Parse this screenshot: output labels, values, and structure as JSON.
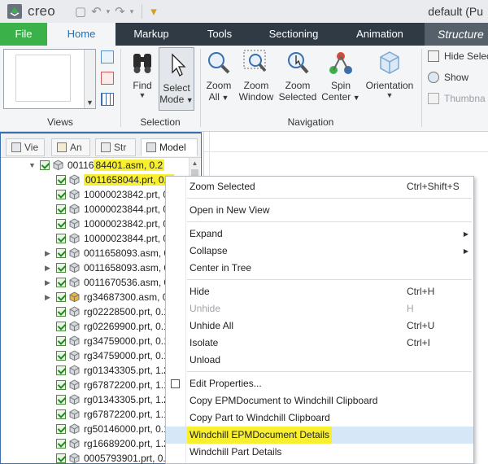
{
  "app": {
    "logo_text": "creo",
    "title": "default (Pu"
  },
  "tabs": [
    {
      "label": "File"
    },
    {
      "label": "Home"
    },
    {
      "label": "Markup"
    },
    {
      "label": "Tools"
    },
    {
      "label": "Sectioning"
    },
    {
      "label": "Animation"
    },
    {
      "label": "Structure"
    }
  ],
  "ribbon": {
    "views_label": "Views",
    "selection_label": "Selection",
    "navigation_label": "Navigation",
    "find_label": "Find",
    "select_mode_l1": "Select",
    "select_mode_l2": "Mode",
    "zoom_all_l1": "Zoom",
    "zoom_all_l2": "All",
    "zoom_window_l1": "Zoom",
    "zoom_window_l2": "Window",
    "zoom_selected_l1": "Zoom",
    "zoom_selected_l2": "Selected",
    "spin_center_l1": "Spin",
    "spin_center_l2": "Center",
    "orientation_label": "Orientation",
    "hide_selected": "Hide Selec",
    "show": "Show",
    "thumbnail": "Thumbna"
  },
  "panel_tabs": [
    {
      "label": "Vie"
    },
    {
      "label": "An"
    },
    {
      "label": "Str"
    },
    {
      "label": "Model"
    }
  ],
  "tree": [
    {
      "pre": "00116",
      "hl": "",
      "label": "84401.asm, 0.2",
      "type": "asm",
      "twisty": "open",
      "indent": 0
    },
    {
      "pre": "",
      "hl": "0011658044.prt, 0.2",
      "label": "",
      "type": "prt",
      "twisty": "",
      "indent": 1
    },
    {
      "pre": "",
      "hl": "",
      "label": "10000023842.prt, 0.",
      "type": "prt",
      "twisty": "",
      "indent": 1
    },
    {
      "pre": "",
      "hl": "",
      "label": "10000023844.prt, 0.",
      "type": "prt",
      "twisty": "",
      "indent": 1
    },
    {
      "pre": "",
      "hl": "",
      "label": "10000023842.prt, 0.",
      "type": "prt",
      "twisty": "",
      "indent": 1
    },
    {
      "pre": "",
      "hl": "",
      "label": "10000023844.prt, 0.",
      "type": "prt",
      "twisty": "",
      "indent": 1
    },
    {
      "pre": "",
      "hl": "",
      "label": "0011658093.asm, 0.",
      "type": "asm",
      "twisty": "closed",
      "indent": 1
    },
    {
      "pre": "",
      "hl": "",
      "label": "0011658093.asm, 0.",
      "type": "asm",
      "twisty": "closed",
      "indent": 1
    },
    {
      "pre": "",
      "hl": "",
      "label": "0011670536.asm, 0.",
      "type": "asm",
      "twisty": "closed",
      "indent": 1
    },
    {
      "pre": "",
      "hl": "",
      "label": "rg34687300.asm, 0.",
      "type": "asm-y",
      "twisty": "closed",
      "indent": 1
    },
    {
      "pre": "",
      "hl": "",
      "label": "rg02228500.prt, 0.1",
      "type": "prt",
      "twisty": "",
      "indent": 1
    },
    {
      "pre": "",
      "hl": "",
      "label": "rg02269900.prt, 0.1",
      "type": "prt",
      "twisty": "",
      "indent": 1
    },
    {
      "pre": "",
      "hl": "",
      "label": "rg34759000.prt, 0.1",
      "type": "prt",
      "twisty": "",
      "indent": 1
    },
    {
      "pre": "",
      "hl": "",
      "label": "rg34759000.prt, 0.1",
      "type": "prt",
      "twisty": "",
      "indent": 1
    },
    {
      "pre": "",
      "hl": "",
      "label": "rg01343305.prt, 1.2",
      "type": "prt",
      "twisty": "",
      "indent": 1
    },
    {
      "pre": "",
      "hl": "",
      "label": "rg67872200.prt, 1.1",
      "type": "prt",
      "twisty": "",
      "indent": 1
    },
    {
      "pre": "",
      "hl": "",
      "label": "rg01343305.prt, 1.2",
      "type": "prt",
      "twisty": "",
      "indent": 1
    },
    {
      "pre": "",
      "hl": "",
      "label": "rg67872200.prt, 1.1",
      "type": "prt",
      "twisty": "",
      "indent": 1
    },
    {
      "pre": "",
      "hl": "",
      "label": "rg50146000.prt, 0.1",
      "type": "prt",
      "twisty": "",
      "indent": 1
    },
    {
      "pre": "",
      "hl": "",
      "label": "rg16689200.prt, 1.2",
      "type": "prt",
      "twisty": "",
      "indent": 1
    },
    {
      "pre": "",
      "hl": "",
      "label": "0005793901.prt, 0.9",
      "type": "prt",
      "twisty": "",
      "indent": 1
    }
  ],
  "context_menu": [
    {
      "label": "Zoom Selected",
      "shortcut": "Ctrl+Shift+S",
      "kind": "item"
    },
    {
      "kind": "sep"
    },
    {
      "label": "Open in New View",
      "shortcut": "",
      "kind": "item"
    },
    {
      "kind": "sep"
    },
    {
      "label": "Expand",
      "shortcut": "",
      "kind": "submenu"
    },
    {
      "label": "Collapse",
      "shortcut": "",
      "kind": "submenu"
    },
    {
      "label": "Center in Tree",
      "shortcut": "",
      "kind": "item"
    },
    {
      "kind": "sep"
    },
    {
      "label": "Hide",
      "shortcut": "Ctrl+H",
      "kind": "item"
    },
    {
      "label": "Unhide",
      "shortcut": "H",
      "kind": "disabled"
    },
    {
      "label": "Unhide All",
      "shortcut": "Ctrl+U",
      "kind": "item"
    },
    {
      "label": "Isolate",
      "shortcut": "Ctrl+I",
      "kind": "item"
    },
    {
      "label": "Unload",
      "shortcut": "",
      "kind": "item"
    },
    {
      "kind": "sep"
    },
    {
      "label": "Edit Properties...",
      "shortcut": "",
      "kind": "checkbox"
    },
    {
      "label": "Copy EPMDocument to Windchill Clipboard",
      "shortcut": "",
      "kind": "item"
    },
    {
      "label": "Copy Part to Windchill Clipboard",
      "shortcut": "",
      "kind": "item"
    },
    {
      "label": "Windchill EPMDocument Details",
      "shortcut": "",
      "kind": "hover"
    },
    {
      "label": "Windchill Part Details",
      "shortcut": "",
      "kind": "item"
    }
  ],
  "colors": {
    "accent": "#3bb14a",
    "tabbar": "#2f3a44",
    "highlight": "#f7ef2f",
    "hover": "#d6e8f7"
  }
}
